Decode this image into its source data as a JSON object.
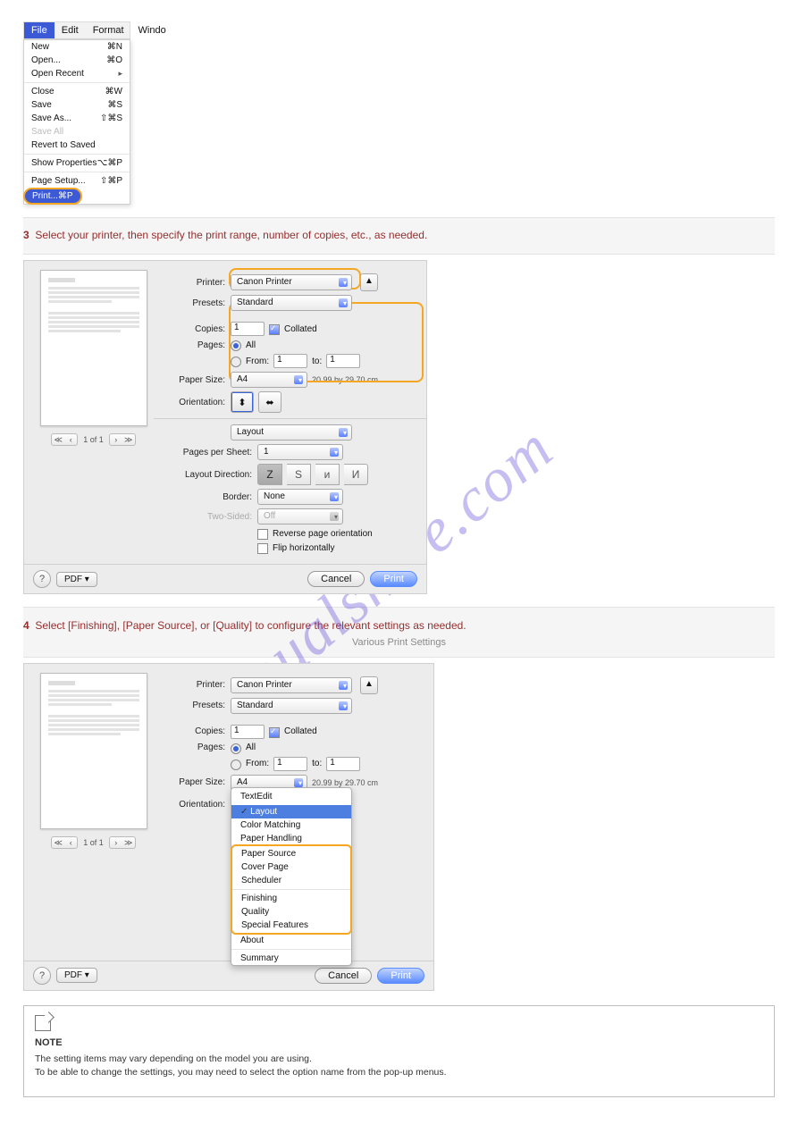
{
  "watermark": "manualshive.com",
  "menubar": {
    "file": "File",
    "edit": "Edit",
    "format": "Format",
    "window": "Windo"
  },
  "filemenu": {
    "new": {
      "label": "New",
      "key": "⌘N"
    },
    "open": {
      "label": "Open...",
      "key": "⌘O"
    },
    "recent": {
      "label": "Open Recent"
    },
    "close": {
      "label": "Close",
      "key": "⌘W"
    },
    "save": {
      "label": "Save",
      "key": "⌘S"
    },
    "saveas": {
      "label": "Save As...",
      "key": "⇧⌘S"
    },
    "saveall": {
      "label": "Save All"
    },
    "revert": {
      "label": "Revert to Saved"
    },
    "props": {
      "label": "Show Properties",
      "key": "⌥⌘P"
    },
    "pagesetup": {
      "label": "Page Setup...",
      "key": "⇧⌘P"
    },
    "print": {
      "label": "Print...",
      "key": "⌘P"
    }
  },
  "step3": {
    "num": "3",
    "text": "Select your printer, then specify the print range, number of copies, etc., as needed."
  },
  "step4": {
    "num": "4",
    "text": "Select [Finishing], [Paper Source], or [Quality] to configure the relevant settings as needed."
  },
  "step4_link": "Various Print Settings",
  "dlg": {
    "printer_lbl": "Printer:",
    "printer_val": "Canon Printer",
    "presets_lbl": "Presets:",
    "presets_val": "Standard",
    "copies_lbl": "Copies:",
    "copies_val": "1",
    "collated": "Collated",
    "pages_lbl": "Pages:",
    "pages_all": "All",
    "pages_from": "From:",
    "from_val": "1",
    "pages_to": "to:",
    "to_val": "1",
    "paper_lbl": "Paper Size:",
    "paper_val": "A4",
    "paper_dim": "20.99 by 29.70 cm",
    "orient_lbl": "Orientation:",
    "section_val": "Layout",
    "pps_lbl": "Pages per Sheet:",
    "pps_val": "1",
    "ldir_lbl": "Layout Direction:",
    "border_lbl": "Border:",
    "border_val": "None",
    "two_lbl": "Two-Sided:",
    "two_val": "Off",
    "rev_lbl": "Reverse page orientation",
    "flip_lbl": "Flip horizontally",
    "pager": "1 of 1",
    "pdf": "PDF ▾",
    "cancel": "Cancel",
    "print": "Print",
    "help": "?",
    "expand": "▲"
  },
  "drop": {
    "textedit": "TextEdit",
    "layout": "Layout",
    "cm": "Color Matching",
    "ph": "Paper Handling",
    "ps": "Paper Source",
    "cp": "Cover Page",
    "sc": "Scheduler",
    "fin": "Finishing",
    "q": "Quality",
    "sf": "Special Features",
    "about": "About",
    "summary": "Summary"
  },
  "note": {
    "title": "NOTE",
    "l1": "The setting items may vary depending on the model you are using.",
    "l2": "To be able to change the settings, you may need to select the option name from the pop-up menus."
  },
  "orient_glyphs": {
    "p": "⬍",
    "l": "⬌"
  },
  "ld_glyphs": {
    "a": "Z",
    "b": "S",
    "c": "ᴎ",
    "d": "И"
  }
}
